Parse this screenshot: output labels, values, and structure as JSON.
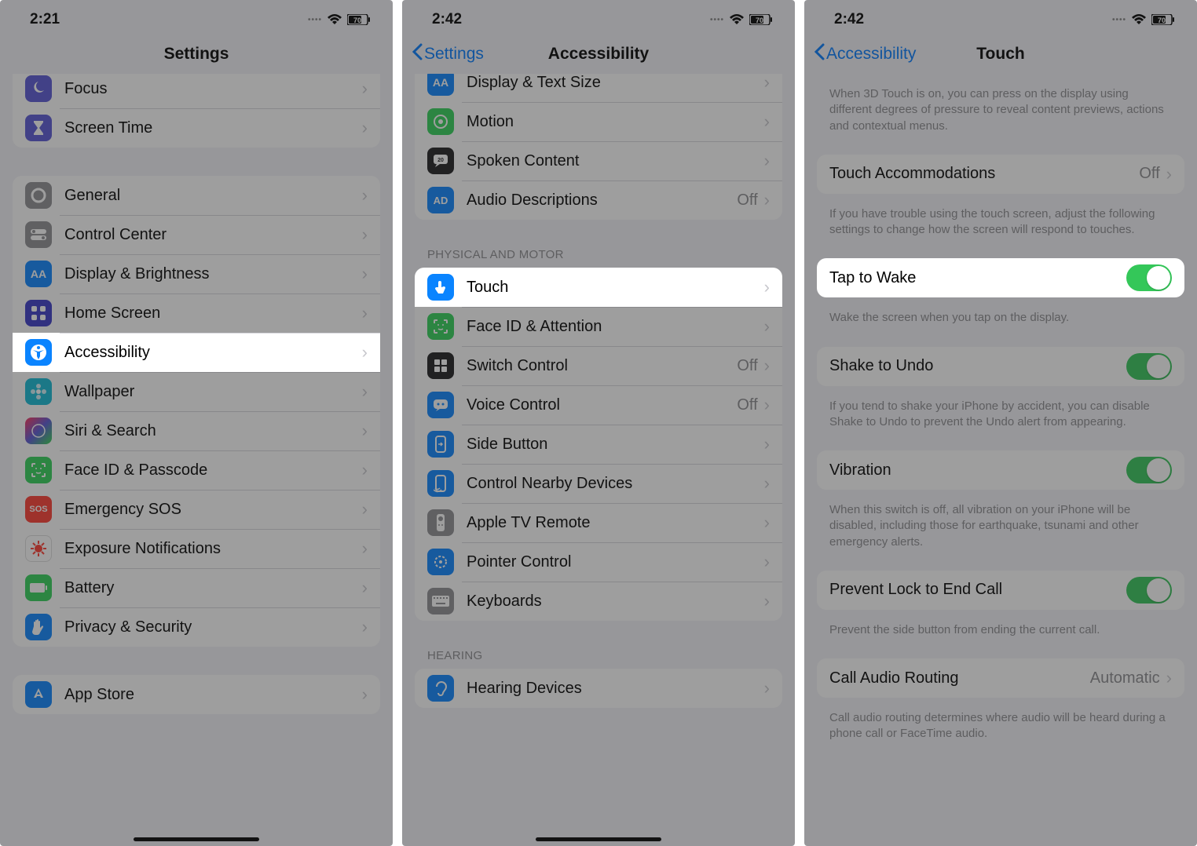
{
  "screens": [
    {
      "statusbar": {
        "time": "2:21",
        "battery": "70"
      },
      "nav": {
        "title": "Settings"
      },
      "groups": [
        {
          "rows": [
            {
              "icon": "focus-icon",
              "label": "Focus",
              "bg": "#5856d6"
            },
            {
              "icon": "hourglass-icon",
              "label": "Screen Time",
              "bg": "#5856d6"
            }
          ]
        },
        {
          "rows": [
            {
              "icon": "gear-icon",
              "label": "General",
              "bg": "#8e8e93"
            },
            {
              "icon": "switches-icon",
              "label": "Control Center",
              "bg": "#8e8e93"
            },
            {
              "icon": "aa-icon",
              "label": "Display & Brightness",
              "bg": "#0a84ff"
            },
            {
              "icon": "grid-icon",
              "label": "Home Screen",
              "bg": "#3a3ac9"
            },
            {
              "icon": "accessibility-icon",
              "label": "Accessibility",
              "bg": "#0a84ff",
              "highlight": true
            },
            {
              "icon": "flower-icon",
              "label": "Wallpaper",
              "bg": "#11bad6"
            },
            {
              "icon": "siri-icon",
              "label": "Siri & Search",
              "bg": "#1c1c1e"
            },
            {
              "icon": "faceid-icon",
              "label": "Face ID & Passcode",
              "bg": "#30d158"
            },
            {
              "icon": "sos-icon",
              "label": "Emergency SOS",
              "bg": "#ff3b30",
              "text": "SOS"
            },
            {
              "icon": "virus-icon",
              "label": "Exposure Notifications",
              "bg": "#ffffff",
              "fg": "#ff3b30"
            },
            {
              "icon": "battery-icon",
              "label": "Battery",
              "bg": "#30d158"
            },
            {
              "icon": "hand-icon",
              "label": "Privacy & Security",
              "bg": "#0a84ff"
            }
          ]
        },
        {
          "rows": [
            {
              "icon": "appstore-icon",
              "label": "App Store",
              "bg": "#0a84ff"
            }
          ]
        }
      ]
    },
    {
      "statusbar": {
        "time": "2:42",
        "battery": "70"
      },
      "nav": {
        "back": "Settings",
        "title": "Accessibility"
      },
      "groups": [
        {
          "rows": [
            {
              "icon": "aa-icon",
              "label": "Display & Text Size",
              "bg": "#0a84ff"
            },
            {
              "icon": "motion-icon",
              "label": "Motion",
              "bg": "#30d158"
            },
            {
              "icon": "bubble-icon",
              "label": "Spoken Content",
              "bg": "#1c1c1e"
            },
            {
              "icon": "ad-icon",
              "label": "Audio Descriptions",
              "bg": "#0a84ff",
              "value": "Off"
            }
          ]
        },
        {
          "header": "PHYSICAL AND MOTOR",
          "rows": [
            {
              "icon": "touch-icon",
              "label": "Touch",
              "bg": "#0a84ff",
              "highlight": true
            },
            {
              "icon": "faceid-icon",
              "label": "Face ID & Attention",
              "bg": "#30d158"
            },
            {
              "icon": "switch-icon",
              "label": "Switch Control",
              "bg": "#1c1c1e",
              "value": "Off"
            },
            {
              "icon": "voice-icon",
              "label": "Voice Control",
              "bg": "#0a84ff",
              "value": "Off"
            },
            {
              "icon": "sidebtn-icon",
              "label": "Side Button",
              "bg": "#0a84ff"
            },
            {
              "icon": "nearby-icon",
              "label": "Control Nearby Devices",
              "bg": "#0a84ff"
            },
            {
              "icon": "remote-icon",
              "label": "Apple TV Remote",
              "bg": "#8e8e93"
            },
            {
              "icon": "pointer-icon",
              "label": "Pointer Control",
              "bg": "#0a84ff"
            },
            {
              "icon": "keyboard-icon",
              "label": "Keyboards",
              "bg": "#8e8e93"
            }
          ]
        },
        {
          "header": "HEARING",
          "rows": [
            {
              "icon": "ear-icon",
              "label": "Hearing Devices",
              "bg": "#0a84ff"
            }
          ]
        }
      ]
    },
    {
      "statusbar": {
        "time": "2:42",
        "battery": "70"
      },
      "nav": {
        "back": "Accessibility",
        "title": "Touch"
      },
      "blocks": [
        {
          "type": "footer",
          "text": "When 3D Touch is on, you can press on the display using different degrees of pressure to reveal content previews, actions and contextual menus."
        },
        {
          "type": "group",
          "rows": [
            {
              "label": "Touch Accommodations",
              "value": "Off",
              "chevron": true
            }
          ]
        },
        {
          "type": "footer",
          "text": "If you have trouble using the touch screen, adjust the following settings to change how the screen will respond to touches."
        },
        {
          "type": "group",
          "highlight": true,
          "rows": [
            {
              "label": "Tap to Wake",
              "toggle": true
            }
          ]
        },
        {
          "type": "footer",
          "text": "Wake the screen when you tap on the display."
        },
        {
          "type": "group",
          "rows": [
            {
              "label": "Shake to Undo",
              "toggle": true
            }
          ]
        },
        {
          "type": "footer",
          "text": "If you tend to shake your iPhone by accident, you can disable Shake to Undo to prevent the Undo alert from appearing."
        },
        {
          "type": "group",
          "rows": [
            {
              "label": "Vibration",
              "toggle": true
            }
          ]
        },
        {
          "type": "footer",
          "text": "When this switch is off, all vibration on your iPhone will be disabled, including those for earthquake, tsunami and other emergency alerts."
        },
        {
          "type": "group",
          "rows": [
            {
              "label": "Prevent Lock to End Call",
              "toggle": true
            }
          ]
        },
        {
          "type": "footer",
          "text": "Prevent the side button from ending the current call."
        },
        {
          "type": "group",
          "rows": [
            {
              "label": "Call Audio Routing",
              "value": "Automatic",
              "chevron": true
            }
          ]
        },
        {
          "type": "footer",
          "text": "Call audio routing determines where audio will be heard during a phone call or FaceTime audio."
        }
      ]
    }
  ]
}
